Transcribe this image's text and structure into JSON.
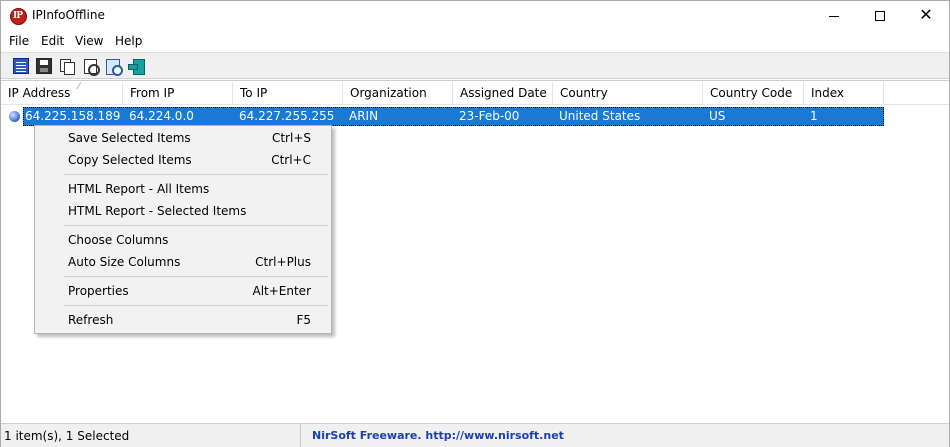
{
  "window": {
    "title": "IPInfoOffline",
    "app_icon_text": "IP",
    "controls": [
      "minimize",
      "maximize",
      "close"
    ]
  },
  "menu": [
    "File",
    "Edit",
    "View",
    "Help"
  ],
  "toolbar": {
    "icons": [
      "properties-icon",
      "save-icon",
      "copy-icon",
      "html-report-icon",
      "find-icon",
      "exit-icon"
    ]
  },
  "table": {
    "columns": [
      "IP Address",
      "From IP",
      "To IP",
      "Organization",
      "Assigned Date",
      "Country",
      "Country Code",
      "Index"
    ],
    "sorted_column": "IP Address",
    "rows": [
      {
        "ip_address": "64.225.158.189",
        "from_ip": "64.224.0.0",
        "to_ip": "64.227.255.255",
        "organization": "ARIN",
        "assigned_date": "23-Feb-00",
        "country": "United States",
        "country_code": "US",
        "index": "1",
        "selected": true
      }
    ]
  },
  "context_menu": {
    "items": [
      {
        "label": "Save Selected Items",
        "shortcut": "Ctrl+S"
      },
      {
        "label": "Copy Selected Items",
        "shortcut": "Ctrl+C"
      },
      {
        "label": "HTML Report - All Items",
        "shortcut": ""
      },
      {
        "label": "HTML Report - Selected Items",
        "shortcut": ""
      },
      {
        "label": "Choose Columns",
        "shortcut": ""
      },
      {
        "label": "Auto Size Columns",
        "shortcut": "Ctrl+Plus"
      },
      {
        "label": "Properties",
        "shortcut": "Alt+Enter"
      },
      {
        "label": "Refresh",
        "shortcut": "F5"
      }
    ]
  },
  "status": {
    "left": "1 item(s), 1 Selected",
    "right": "NirSoft Freeware.  http://www.nirsoft.net"
  },
  "colors": {
    "selection": "#1979d4",
    "nirsoft_link": "#1a3fb0"
  }
}
